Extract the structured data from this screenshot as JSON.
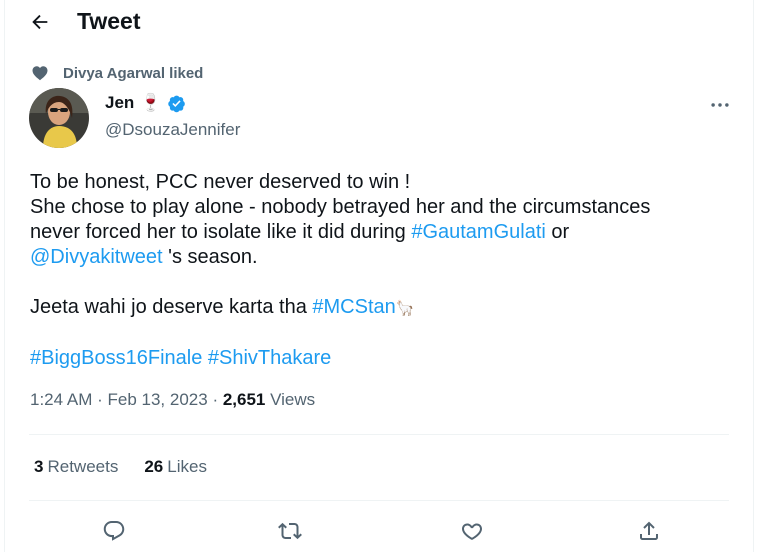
{
  "header": {
    "title": "Tweet"
  },
  "social_context": {
    "text": "Divya Agarwal liked"
  },
  "author": {
    "name": "Jen",
    "name_emoji": "🍷",
    "handle": "@DsouzaJennifer",
    "verified": true
  },
  "tweet": {
    "line1": "To be honest, PCC never deserved to win !",
    "line2": "She chose to play alone - nobody betrayed her and the circumstances",
    "line3_text": "never forced her to isolate like it did during ",
    "line3_hashtag": "#GautamGulati",
    "line3_tail": " or",
    "line4_mention": "@Divyakitweet",
    "line4_tail": " 's season.",
    "line5_text": "Jeeta wahi jo deserve karta tha ",
    "line5_hashtag": "#MCStan",
    "line5_emoji": "🦙",
    "hashtag_a": "#BiggBoss16Finale",
    "hashtag_b": "#ShivThakare"
  },
  "meta": {
    "time": "1:24 AM",
    "date": "Feb 13, 2023",
    "views_count": "2,651",
    "views_label": "Views"
  },
  "stats": {
    "retweets_count": "3",
    "retweets_label": "Retweets",
    "likes_count": "26",
    "likes_label": "Likes"
  },
  "colors": {
    "accent": "#1d9bf0",
    "secondary_text": "#536471",
    "primary_text": "#0f1419"
  },
  "icons": [
    "back-arrow-icon",
    "heart-icon",
    "verified-badge-icon",
    "more-icon",
    "reply-icon",
    "retweet-icon",
    "like-icon",
    "share-icon"
  ]
}
